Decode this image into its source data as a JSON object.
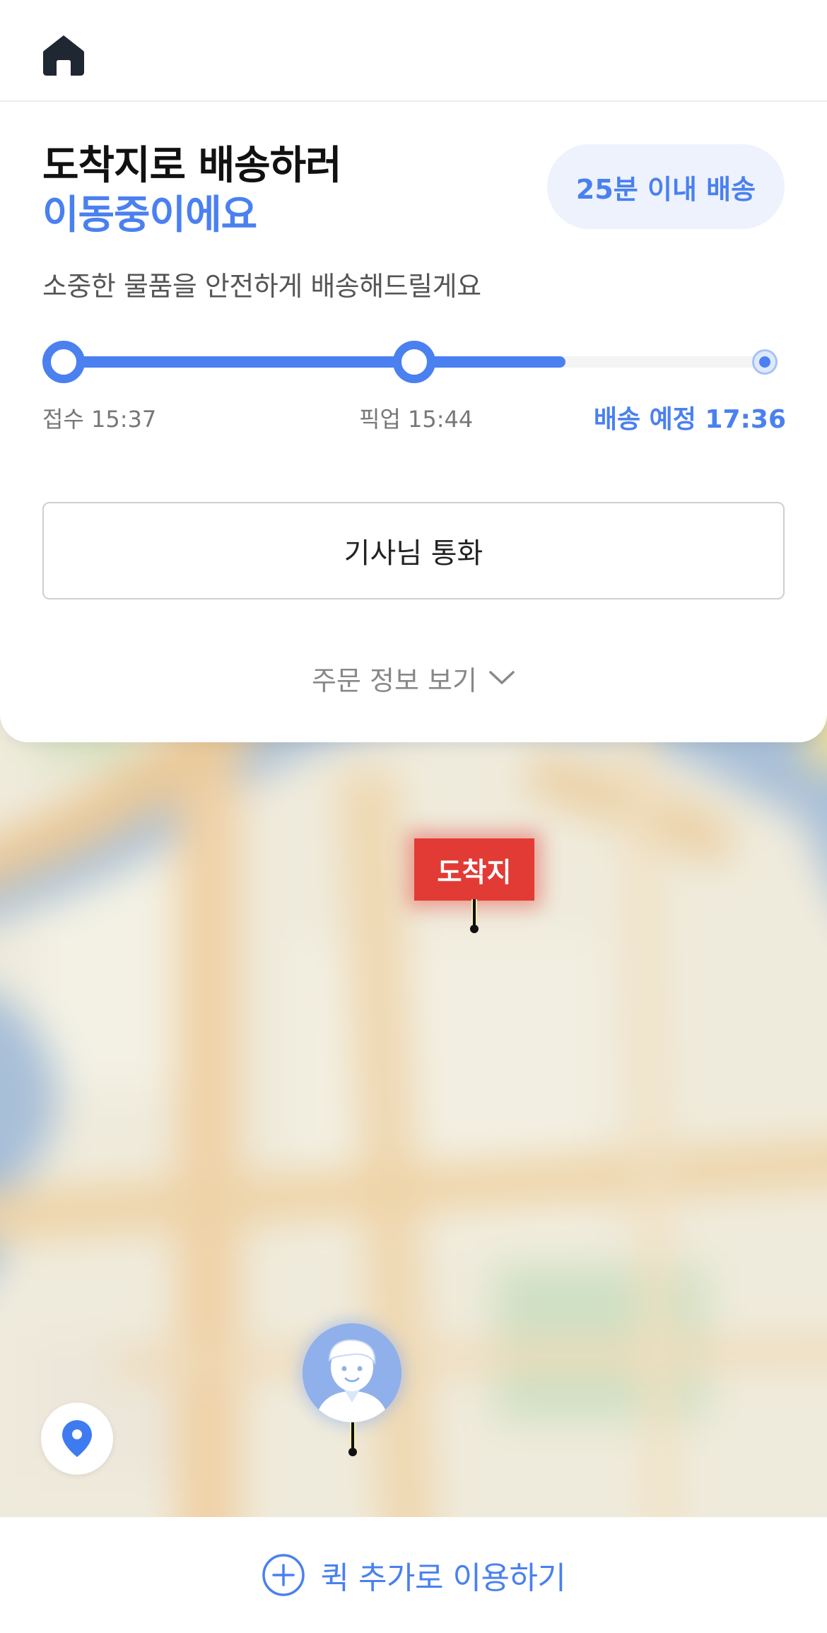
{
  "header": {
    "home_icon": "home-icon"
  },
  "status": {
    "title_line1": "도착지로 배송하러",
    "title_line2": "이동중이에요",
    "eta_badge": "25분 이내 배송",
    "subtitle": "소중한 물품을 안전하게 배송해드릴게요",
    "progress_fraction": 0.71,
    "steps": [
      {
        "label": "접수 15:37"
      },
      {
        "label": "픽업 15:44"
      },
      {
        "label": "배송 예정 17:36"
      }
    ],
    "call_button": "기사님 통화",
    "order_info_toggle": "주문 정보 보기"
  },
  "map": {
    "destination_label": "도착지",
    "driver_marker": "driver-avatar",
    "locate_icon": "location-pin-icon"
  },
  "bottom": {
    "action_label": "퀵 추가로 이용하기",
    "action_icon": "plus-circle-icon"
  },
  "colors": {
    "accent": "#4a80f0",
    "destination": "#e23b35",
    "badge_bg": "#edf2fd"
  }
}
